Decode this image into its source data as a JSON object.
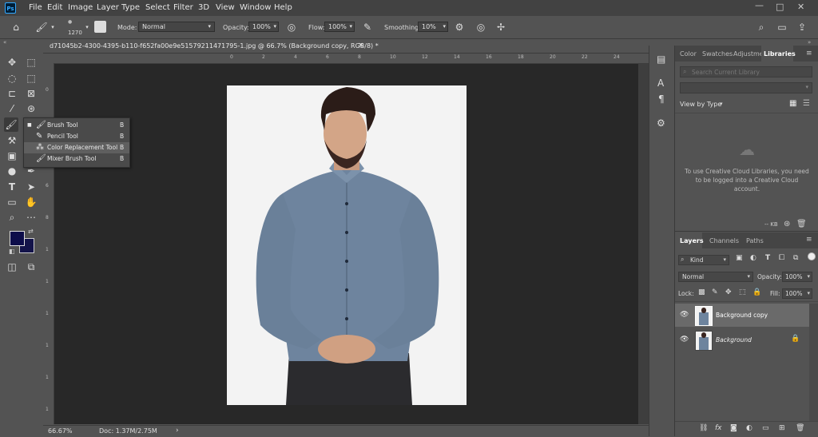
{
  "menubar": {
    "app_badge": "Ps",
    "items": [
      "File",
      "Edit",
      "Image",
      "Layer",
      "Type",
      "Select",
      "Filter",
      "3D",
      "View",
      "Window",
      "Help"
    ]
  },
  "options": {
    "brush_size": "1270",
    "mode_label": "Mode:",
    "mode_value": "Normal",
    "opacity_label": "Opacity:",
    "opacity_value": "100%",
    "flow_label": "Flow:",
    "flow_value": "100%",
    "smoothing_label": "Smoothing:",
    "smoothing_value": "10%"
  },
  "document": {
    "tab_title": "d71045b2-4300-4395-b110-f652fa00e9e51579211471795-1.jpg @ 66.7% (Background copy, RGB/8) *",
    "close": "×",
    "zoom": "66.67%",
    "doc_info": "Doc: 1.37M/2.75M"
  },
  "ruler": {
    "top": [
      "0",
      "2",
      "4",
      "6",
      "8",
      "10",
      "12",
      "14",
      "16",
      "18",
      "20",
      "22",
      "24",
      "26"
    ],
    "left": [
      "0",
      "2",
      "4",
      "6",
      "8",
      "1",
      "1",
      "1",
      "1",
      "1",
      "1"
    ]
  },
  "flyout": {
    "items": [
      {
        "label": "Brush Tool",
        "key": "B",
        "active": true
      },
      {
        "label": "Pencil Tool",
        "key": "B"
      },
      {
        "label": "Color Replacement Tool",
        "key": "B",
        "highlight": true
      },
      {
        "label": "Mixer Brush Tool",
        "key": "B"
      }
    ]
  },
  "colors": {
    "foreground": "#0d0d4a",
    "background": "#14144a",
    "accent": "#31a8ff"
  },
  "libraries": {
    "tabs": [
      "Color",
      "Swatches",
      "Adjustme",
      "Libraries"
    ],
    "search_placeholder": "Search Current Library",
    "view_by": "View by Type",
    "message": "To use Creative Cloud Libraries, you need to be logged into a Creative Cloud account.",
    "footer_size": "-- KB"
  },
  "layers": {
    "tabs": [
      "Layers",
      "Channels",
      "Paths"
    ],
    "kind": "Kind",
    "blend": "Normal",
    "opacity_label": "Opacity:",
    "opacity_value": "100%",
    "lock_label": "Lock:",
    "fill_label": "Fill:",
    "fill_value": "100%",
    "rows": [
      {
        "name": "Background copy",
        "selected": true
      },
      {
        "name": "Background",
        "locked": true
      }
    ],
    "footer_icons": [
      "link-icon",
      "fx-icon",
      "mask-icon",
      "adjustment-icon",
      "group-icon",
      "new-layer-icon",
      "trash-icon"
    ],
    "fx_label": "fx"
  }
}
